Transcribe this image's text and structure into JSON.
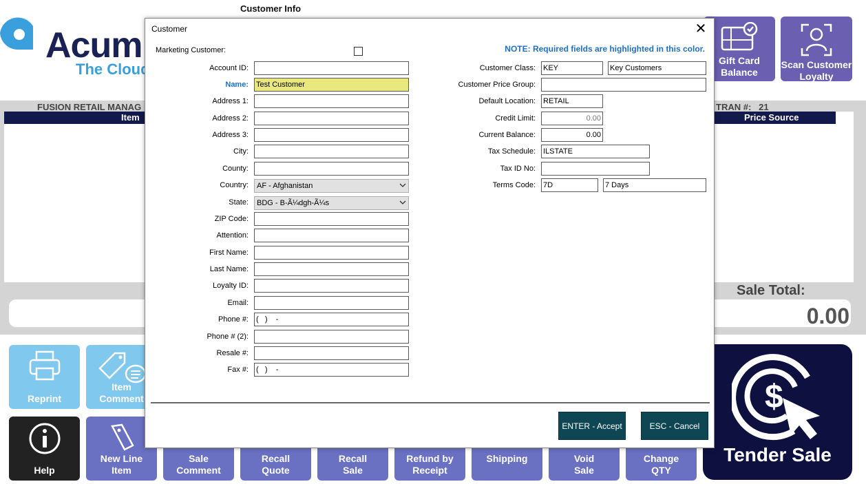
{
  "app": {
    "brand": "Acum",
    "tagline": "The Cloud",
    "customer_info_label": "Customer Info",
    "fusion_title": "FUSION RETAIL MANAG",
    "tran_label": "TRAN #:",
    "tran_number": "21",
    "grid_columns": {
      "item": "Item",
      "price_source": "Price Source"
    },
    "sale_total_label": "Sale Total:",
    "sale_total_value": "0.00"
  },
  "top_buttons": [
    {
      "label1": "Gift Card",
      "label2": "Balance",
      "icon": "gift-card-icon"
    },
    {
      "label1": "Scan Customer",
      "label2": "Loyalty",
      "icon": "scan-customer-icon"
    }
  ],
  "action_buttons": {
    "reprint": {
      "label1": "Reprint",
      "label2": ""
    },
    "item_comment": {
      "label1": "Item",
      "label2": "Comment"
    },
    "help": {
      "label1": "Help",
      "label2": ""
    },
    "new_line_item": {
      "label1": "New Line",
      "label2": "Item"
    },
    "sale_comment": {
      "label1": "Sale",
      "label2": "Comment"
    },
    "recall_quote": {
      "label1": "Recall",
      "label2": "Quote"
    },
    "recall_sale": {
      "label1": "Recall",
      "label2": "Sale"
    },
    "refund_receipt": {
      "label1": "Refund by",
      "label2": "Receipt"
    },
    "shipping": {
      "label1": "Shipping",
      "label2": ""
    },
    "void_sale": {
      "label1": "Void",
      "label2": "Sale"
    },
    "change_qty": {
      "label1": "Change",
      "label2": "QTY"
    },
    "tender_sale": {
      "label1": "Tender Sale",
      "label2": ""
    }
  },
  "dialog": {
    "title": "Customer",
    "note": "NOTE: Required fields are highlighted in this color.",
    "marketing_label": "Marketing Customer:",
    "marketing_checked": false,
    "left_fields": {
      "account_id": {
        "label": "Account ID:",
        "value": ""
      },
      "name": {
        "label": "Name:",
        "value": "Test Customer"
      },
      "address1": {
        "label": "Address 1:",
        "value": ""
      },
      "address2": {
        "label": "Address 2:",
        "value": ""
      },
      "address3": {
        "label": "Address 3:",
        "value": ""
      },
      "city": {
        "label": "City:",
        "value": ""
      },
      "county": {
        "label": "County:",
        "value": ""
      },
      "country": {
        "label": "Country:",
        "value": "AF - Afghanistan"
      },
      "state": {
        "label": "State:",
        "value": "BDG - B-Ã¼dgh-Ã¼s"
      },
      "zip": {
        "label": "ZIP Code:",
        "value": ""
      },
      "attention": {
        "label": "Attention:",
        "value": ""
      },
      "first_name": {
        "label": "First Name:",
        "value": ""
      },
      "last_name": {
        "label": "Last Name:",
        "value": ""
      },
      "loyalty_id": {
        "label": "Loyalty ID:",
        "value": ""
      },
      "email": {
        "label": "Email:",
        "value": ""
      },
      "phone": {
        "label": "Phone #:",
        "value": "(   )    -"
      },
      "phone2": {
        "label": "Phone # (2):",
        "value": ""
      },
      "resale": {
        "label": "Resale #:",
        "value": ""
      },
      "fax": {
        "label": "Fax #:",
        "value": "(   )    -"
      }
    },
    "right_fields": {
      "customer_class": {
        "label": "Customer Class:",
        "code": "KEY",
        "desc": "Key Customers"
      },
      "price_group": {
        "label": "Customer Price Group:",
        "value": ""
      },
      "default_location": {
        "label": "Default Location:",
        "value": "RETAIL"
      },
      "credit_limit": {
        "label": "Credit Limit:",
        "value": "0.00"
      },
      "current_balance": {
        "label": "Current Balance:",
        "value": "0.00"
      },
      "tax_schedule": {
        "label": "Tax Schedule:",
        "value": "ILSTATE"
      },
      "tax_id": {
        "label": "Tax ID No:",
        "value": ""
      },
      "terms_code": {
        "label": "Terms Code:",
        "code": "7D",
        "desc": "7 Days"
      }
    },
    "buttons": {
      "accept": "ENTER - Accept",
      "cancel": "ESC - Cancel"
    }
  }
}
